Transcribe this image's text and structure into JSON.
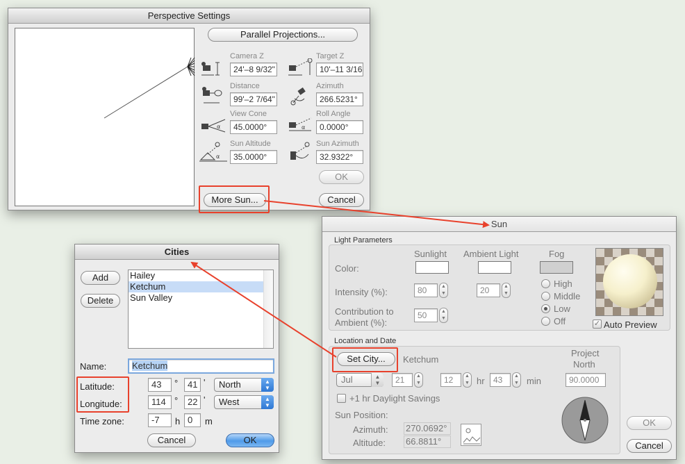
{
  "perspective": {
    "title": "Perspective Settings",
    "parallel_label": "Parallel Projections...",
    "camera_z": {
      "label": "Camera Z",
      "value": "24'–8 9/32\""
    },
    "target_z": {
      "label": "Target Z",
      "value": "10'–11 3/16\""
    },
    "distance": {
      "label": "Distance",
      "value": "99'–2 7/64\""
    },
    "azimuth": {
      "label": "Azimuth",
      "value": "266.5231°"
    },
    "view_cone": {
      "label": "View Cone",
      "value": "45.0000°"
    },
    "roll_angle": {
      "label": "Roll Angle",
      "value": "0.0000°"
    },
    "sun_altitude": {
      "label": "Sun Altitude",
      "value": "35.0000°"
    },
    "sun_azimuth": {
      "label": "Sun Azimuth",
      "value": "32.9322°"
    },
    "ok_label": "OK",
    "cancel_label": "Cancel",
    "more_sun_label": "More Sun..."
  },
  "sun": {
    "title": "Sun",
    "light_params_label": "Light Parameters",
    "col_sunlight": "Sunlight",
    "col_ambient": "Ambient Light",
    "col_fog": "Fog",
    "color_label": "Color:",
    "intensity_label": "Intensity (%):",
    "intensity_sun": "80",
    "intensity_amb": "20",
    "contribution_label_1": "Contribution to",
    "contribution_label_2": "Ambient (%):",
    "contribution_value": "50",
    "fog_options": [
      "High",
      "Middle",
      "Low",
      "Off"
    ],
    "fog_selected": "Low",
    "auto_preview_label": "Auto Preview",
    "location_label": "Location and Date",
    "set_city_label": "Set City...",
    "city_value": "Ketchum",
    "project_north_label_1": "Project",
    "project_north_label_2": "North",
    "project_north_value": "90.0000",
    "month": "Jul",
    "day": "21",
    "hour": "12",
    "hr_label": "hr",
    "minute": "43",
    "min_label": "min",
    "daylight_label": "+1 hr Daylight Savings",
    "sun_position_label": "Sun Position:",
    "azimuth_label": "Azimuth:",
    "azimuth_value": "270.0692°",
    "altitude_label": "Altitude:",
    "altitude_value": "66.8811°",
    "ok_label": "OK",
    "cancel_label": "Cancel"
  },
  "cities": {
    "title": "Cities",
    "add_label": "Add",
    "delete_label": "Delete",
    "list": [
      "Hailey",
      "Ketchum",
      "Sun Valley"
    ],
    "selected": "Ketchum",
    "name_label": "Name:",
    "name_value": "Ketchum",
    "latitude_label": "Latitude:",
    "lat_deg": "43",
    "lat_min": "41",
    "lat_dir": "North",
    "longitude_label": "Longitude:",
    "lon_deg": "114",
    "lon_min": "22",
    "lon_dir": "West",
    "timezone_label": "Time zone:",
    "tz_hours": "-7",
    "h_label": "h",
    "tz_minutes": "0",
    "m_label": "m",
    "deg_symbol": "°",
    "min_symbol": "'",
    "cancel_label": "Cancel",
    "ok_label": "OK"
  },
  "colors": {
    "annotation_red": "#e8412c",
    "selection_blue": "#c7dcf7",
    "default_button_blue": "#4f9be9",
    "fog_gray": "#d0d0d0"
  }
}
